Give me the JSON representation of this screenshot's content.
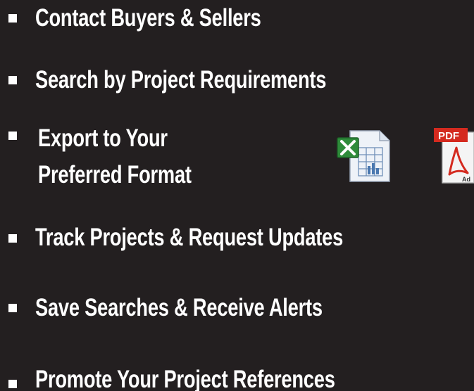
{
  "features": [
    {
      "label": "Contact Buyers & Sellers"
    },
    {
      "label": "Search by Project Requirements"
    },
    {
      "label_line1": "Export to Your",
      "label_line2": "Preferred Format"
    },
    {
      "label": "Track Projects & Request Updates"
    },
    {
      "label": "Save Searches & Receive Alerts"
    },
    {
      "label": "Promote Your Project References"
    }
  ],
  "icons": {
    "excel": "excel-file-icon",
    "pdf": "pdf-file-icon",
    "pdf_badge": "PDF",
    "pdf_corner": "Ad"
  },
  "colors": {
    "background": "#231f20",
    "text": "#ffffff",
    "excel_green": "#2e8b3a",
    "pdf_red": "#d42a1f"
  }
}
